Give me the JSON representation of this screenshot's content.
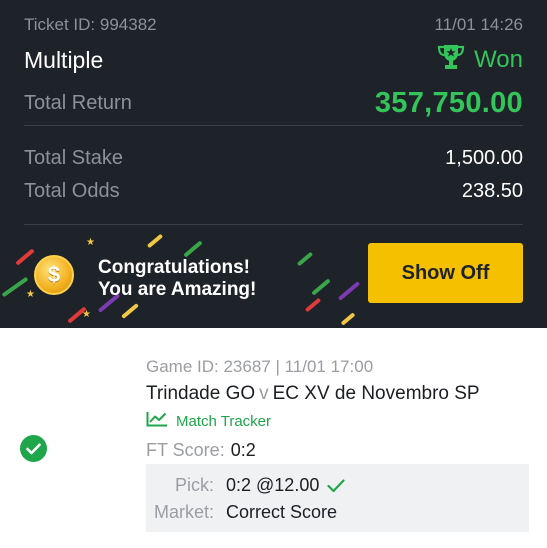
{
  "ticket": {
    "id_label": "Ticket ID: 994382",
    "datetime": "11/01 14:26",
    "type": "Multiple",
    "status": "Won",
    "total_return_label": "Total Return",
    "total_return": "357,750.00",
    "total_stake_label": "Total Stake",
    "total_stake": "1,500.00",
    "total_odds_label": "Total Odds",
    "total_odds": "238.50"
  },
  "banner": {
    "line1": "Congratulations!",
    "line2": "You are Amazing!",
    "coin_symbol": "$",
    "show_off_label": "Show Off"
  },
  "selection": {
    "game_info": "Game ID: 23687 | 11/01 17:00",
    "home_team": "Trindade GO",
    "vs": "v",
    "away_team": "EC XV de Novembro SP",
    "match_tracker_label": "Match Tracker",
    "ft_score_label": "FT Score:",
    "ft_score": "0:2",
    "pick_label": "Pick:",
    "pick_value": "0:2 @12.00",
    "market_label": "Market:",
    "market_value": "Correct Score"
  },
  "colors": {
    "header_bg": "#1e2229",
    "accent_green": "#33c55a",
    "button_yellow": "#f5c000"
  },
  "icons": {
    "status": "trophy-icon",
    "tracker": "chart-line-icon",
    "pick_result": "checkmark-icon",
    "selection_status": "check-circle-icon"
  }
}
